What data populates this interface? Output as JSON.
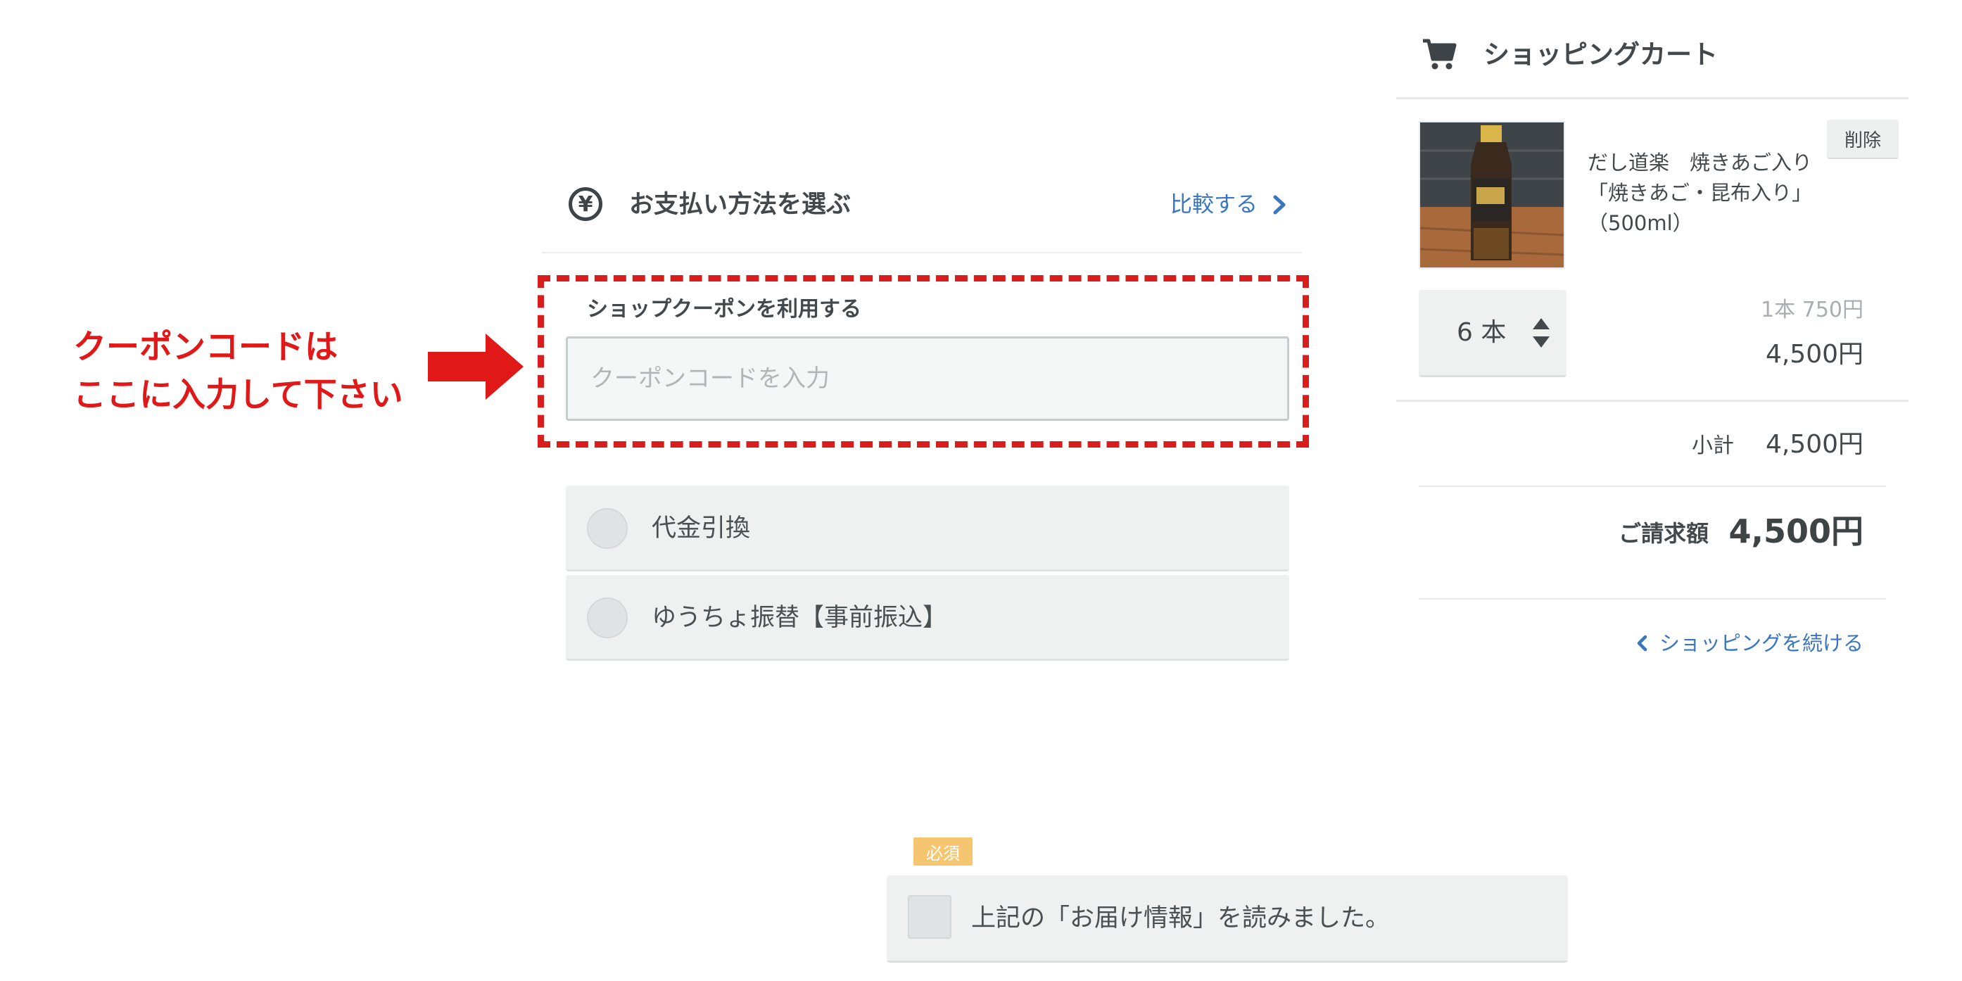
{
  "annotation": {
    "line1": "クーポンコードは",
    "line2": "ここに入力して下さい",
    "color": "#e01818"
  },
  "payment": {
    "title": "お支払い方法を選ぶ",
    "title_icon": "yen-circle-icon",
    "compare_link": "比較する",
    "coupon": {
      "label": "ショップクーポンを利用する",
      "placeholder": "クーポンコードを入力",
      "value": ""
    },
    "options": [
      {
        "label": "代金引換",
        "selected": false
      },
      {
        "label": "ゆうちょ振替【事前振込】",
        "selected": false
      }
    ]
  },
  "cart": {
    "title": "ショッピングカート",
    "icon": "shopping-cart-icon",
    "item": {
      "name_line1": "だし道楽　焼きあご入り",
      "name_line2": "「焼きあご・昆布入り」",
      "name_line3": "（500ml）",
      "delete_label": "削除",
      "quantity": "6 本",
      "unit_price": "1本 750円",
      "line_total": "4,500円"
    },
    "subtotal_label": "小計",
    "subtotal_value": "4,500円",
    "billing_label": "ご請求額",
    "billing_value": "4,500円",
    "continue_label": "ショッピングを続ける"
  },
  "agreement": {
    "required_badge": "必須",
    "label": "上記の「お届け情報」を読みました。",
    "checked": false
  },
  "colors": {
    "link": "#3a76c0",
    "text": "#43484c",
    "required_badge": "#f5c66f",
    "annotation_red": "#e01818"
  }
}
